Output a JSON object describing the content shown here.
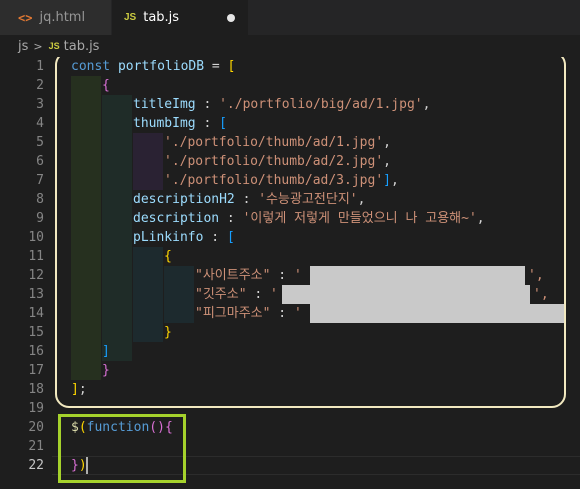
{
  "tabs": [
    {
      "icon": "html-file-icon",
      "icon_glyph": "<>",
      "label": "jq.html",
      "active": false
    },
    {
      "icon": "js-file-icon",
      "icon_glyph": "JS",
      "label": "tab.js",
      "active": true,
      "unsaved": true
    }
  ],
  "breadcrumb": {
    "folder": "js",
    "separator": ">",
    "file_icon": "JS",
    "file": "tab.js"
  },
  "editor": {
    "line_numbers": [
      "1",
      "2",
      "3",
      "4",
      "5",
      "6",
      "7",
      "8",
      "9",
      "10",
      "11",
      "12",
      "13",
      "14",
      "15",
      "16",
      "17",
      "18",
      "19",
      "20",
      "21",
      "22"
    ],
    "current_line": "22",
    "lines": {
      "l1": {
        "kw": "const",
        "name": "portfolioDB",
        "eq": " = ",
        "open": "["
      },
      "l2": {
        "open": "{"
      },
      "l3": {
        "key": "titleImg",
        "colon": " : ",
        "value": "'./portfolio/big/ad/1.jpg'",
        "comma": ","
      },
      "l4": {
        "key": "thumbImg",
        "colon": " : ",
        "open": "["
      },
      "l5": {
        "value": "'./portfolio/thumb/ad/1.jpg'",
        "comma": ","
      },
      "l6": {
        "value": "'./portfolio/thumb/ad/2.jpg'",
        "comma": ","
      },
      "l7": {
        "value": "'./portfolio/thumb/ad/3.jpg'",
        "close": "]",
        "comma": ","
      },
      "l8": {
        "key": "descriptionH2",
        "colon": " : ",
        "value": "'수능광고전단지'",
        "comma": ","
      },
      "l9": {
        "key": "description",
        "colon": " : ",
        "value": "'이렇게 저렇게 만들었으니 나 고용해~'",
        "comma": ","
      },
      "l10": {
        "key": "pLinkinfo",
        "colon": " : ",
        "open": "["
      },
      "l11": {
        "open": "{"
      },
      "l12": {
        "key": "\"사이트주소\"",
        "colon": " : ",
        "quote": "'",
        "comma": "',"
      },
      "l13": {
        "key": "\"깃주소\"",
        "colon": " : ",
        "quote": "'",
        "comma": "',"
      },
      "l14": {
        "key": "\"피그마주소\"",
        "colon": " : ",
        "quote": "'"
      },
      "l15": {
        "close": "}"
      },
      "l16": {
        "close": "]"
      },
      "l17": {
        "close": "}"
      },
      "l18": {
        "close": "]",
        "semi": ";"
      },
      "l20": {
        "dollar": "$",
        "paren": "(",
        "kw": "function",
        "args": "()",
        "brace": "{"
      },
      "l22": {
        "brace": "}",
        "paren": ")"
      }
    }
  },
  "colors": {
    "tab_bar": "#252526",
    "editor_bg": "#1e1e1e",
    "keyword": "#569cd6",
    "variable": "#9cdcfe",
    "string": "#ce9178",
    "bracket_gold": "#ffd700",
    "bracket_orchid": "#da70d6",
    "bracket_blue": "#179fff",
    "annotation_yellow": "#f2e9c0",
    "annotation_green": "#a5d22c"
  }
}
